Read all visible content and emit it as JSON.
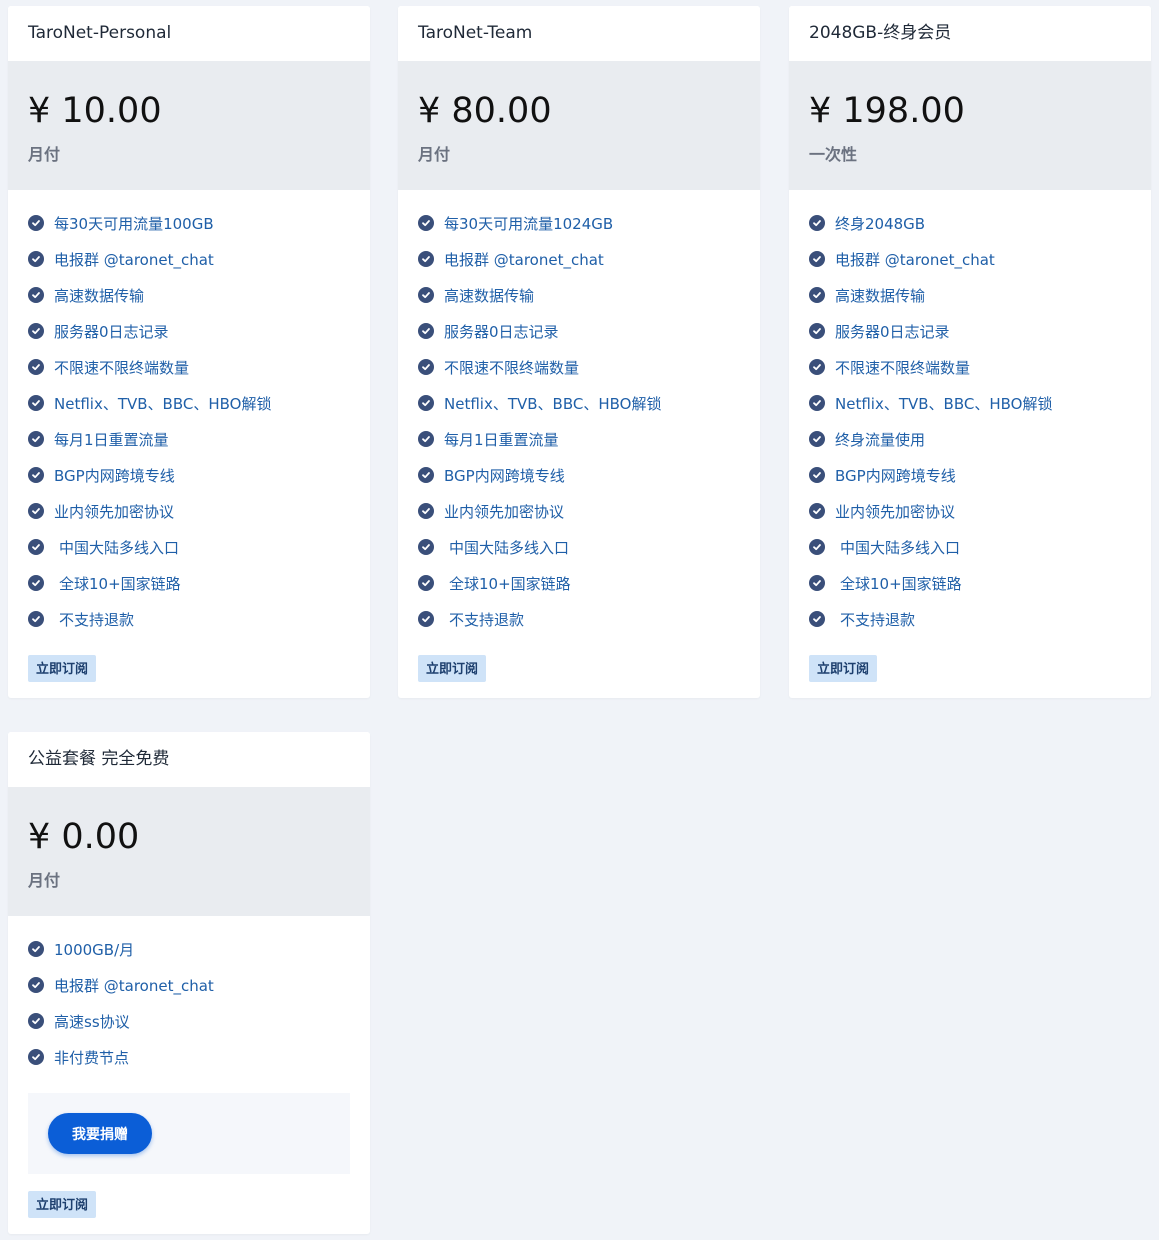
{
  "plans": [
    {
      "title": "TaroNet-Personal",
      "price": "¥ 10.00",
      "period": "月付",
      "features": [
        "每30天可用流量100GB",
        "电报群 @taronet_chat",
        "高速数据传输",
        "服务器0日志记录",
        "不限速不限终端数量",
        "Netflix、TVB、BBC、HBO解锁",
        "每月1日重置流量",
        "BGP内网跨境专线",
        "业内领先加密协议",
        "中国大陆多线入口",
        "全球10+国家链路",
        "不支持退款"
      ],
      "subscribe_label": "立即订阅"
    },
    {
      "title": "TaroNet-Team",
      "price": "¥ 80.00",
      "period": "月付",
      "features": [
        "每30天可用流量1024GB",
        "电报群 @taronet_chat",
        "高速数据传输",
        "服务器0日志记录",
        "不限速不限终端数量",
        "Netflix、TVB、BBC、HBO解锁",
        "每月1日重置流量",
        "BGP内网跨境专线",
        "业内领先加密协议",
        "中国大陆多线入口",
        "全球10+国家链路",
        "不支持退款"
      ],
      "subscribe_label": "立即订阅"
    },
    {
      "title": "2048GB-终身会员",
      "price": "¥ 198.00",
      "period": "一次性",
      "features": [
        "终身2048GB",
        "电报群 @taronet_chat",
        "高速数据传输",
        "服务器0日志记录",
        "不限速不限终端数量",
        "Netflix、TVB、BBC、HBO解锁",
        "终身流量使用",
        "BGP内网跨境专线",
        "业内领先加密协议",
        "中国大陆多线入口",
        "全球10+国家链路",
        "不支持退款"
      ],
      "subscribe_label": "立即订阅"
    },
    {
      "title": "公益套餐 完全免费",
      "price": "¥ 0.00",
      "period": "月付",
      "features": [
        "1000GB/月",
        "电报群 @taronet_chat",
        "高速ss协议",
        "非付费节点"
      ],
      "donate_label": "我要捐赠",
      "subscribe_label": "立即订阅"
    }
  ],
  "icons": {
    "check": "check-circle-icon"
  },
  "colors": {
    "page_bg": "#f0f3f8",
    "price_bg": "#e9ecf0",
    "feature_text": "#1f5fa8",
    "check_icon": "#3a4f7a",
    "subscribe_bg": "#cfe3f8",
    "donate_bg": "#0b5ed7"
  }
}
